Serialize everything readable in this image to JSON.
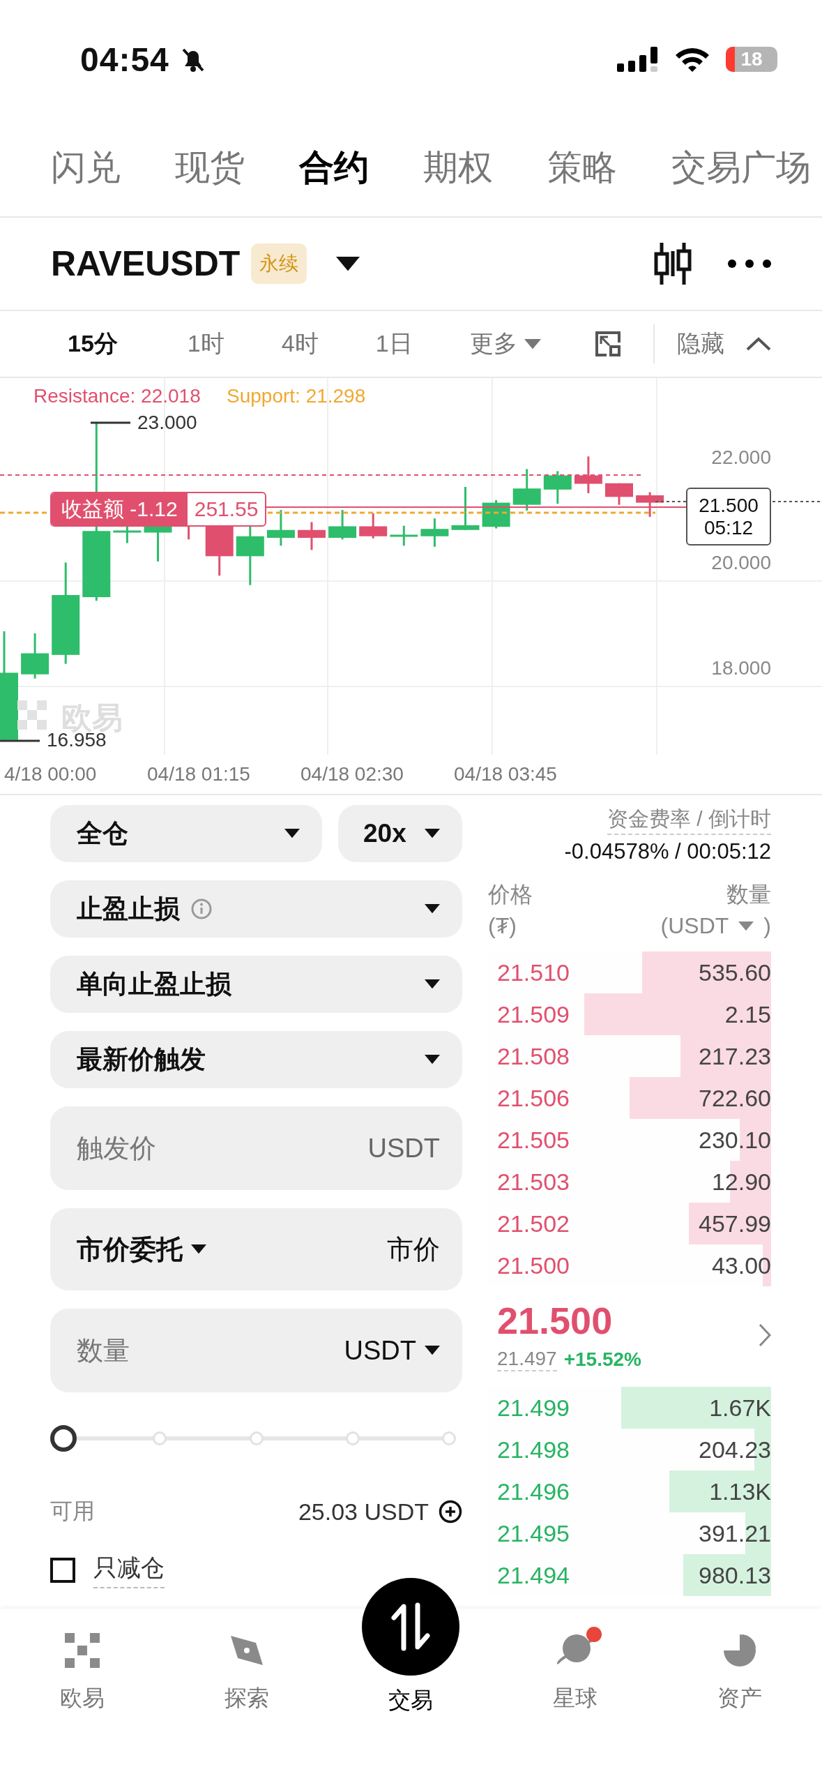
{
  "status_bar": {
    "time": "04:54",
    "battery": "18"
  },
  "top_tabs": [
    {
      "label": "闪兑",
      "selected": false
    },
    {
      "label": "现货",
      "selected": false
    },
    {
      "label": "合约",
      "selected": true
    },
    {
      "label": "期权",
      "selected": false
    },
    {
      "label": "策略",
      "selected": false
    },
    {
      "label": "交易广场",
      "selected": false
    }
  ],
  "symbol": {
    "name": "RAVEUSDT",
    "badge": "永续"
  },
  "timeframes": [
    {
      "label": "15分",
      "selected": true
    },
    {
      "label": "1时",
      "selected": false
    },
    {
      "label": "4时",
      "selected": false
    },
    {
      "label": "1日",
      "selected": false
    }
  ],
  "more": "更多",
  "hide": "隐藏",
  "chart": {
    "resistance": "Resistance: 22.018",
    "support": "Support: 21.298",
    "high": "23.000",
    "low": "16.958",
    "watermark": "欧易",
    "position_label": "收益额 -1.12",
    "position_value": "251.55",
    "price_tag": "21.500",
    "countdown": "05:12",
    "y_ticks": [
      "22.000",
      "20.000",
      "18.000"
    ],
    "x_ticks": [
      "4/18 00:00",
      "04/18 01:15",
      "04/18 02:30",
      "04/18 03:45"
    ]
  },
  "order_form": {
    "margin_mode": "全仓",
    "leverage": "20x",
    "tpsl": "止盈止损",
    "tpsl_mode": "单向止盈止损",
    "trigger_type": "最新价触发",
    "trigger_price": {
      "placeholder": "触发价",
      "unit": "USDT"
    },
    "order_type": "市价委托",
    "order_price": "市价",
    "amount": {
      "placeholder": "数量",
      "unit": "USDT"
    },
    "slider": {
      "level": 0
    },
    "available_label": "可用",
    "available": "25.03 USDT",
    "reduce_only": {
      "label": "只减仓",
      "checked": false
    }
  },
  "order_book": {
    "funding_label": "资金费率 / 倒计时",
    "funding_value": "-0.04578% / 00:05:12",
    "price_header": "价格",
    "price_unit": "(₮)",
    "amount_header": "数量",
    "amount_unit": "(USDT",
    "amount_unit_close": ")",
    "asks": [
      {
        "price": "21.510",
        "amount": "535.60",
        "level": 0.455
      },
      {
        "price": "21.509",
        "amount": "2.15",
        "level": 0.66
      },
      {
        "price": "21.508",
        "amount": "217.23",
        "level": 0.32
      },
      {
        "price": "21.506",
        "amount": "722.60",
        "level": 0.5
      },
      {
        "price": "21.505",
        "amount": "230.10",
        "level": 0.11
      },
      {
        "price": "21.503",
        "amount": "12.90",
        "level": 0.145
      },
      {
        "price": "21.502",
        "amount": "457.99",
        "level": 0.29
      },
      {
        "price": "21.500",
        "amount": "43.00",
        "level": 0.03
      }
    ],
    "last_price": "21.500",
    "mark_price": "21.497",
    "change": "+15.52%",
    "bids": [
      {
        "price": "21.499",
        "amount": "1.67K",
        "level": 0.53
      },
      {
        "price": "21.498",
        "amount": "204.23",
        "level": 0.06
      },
      {
        "price": "21.496",
        "amount": "1.13K",
        "level": 0.36
      },
      {
        "price": "21.495",
        "amount": "391.21",
        "level": 0.09
      },
      {
        "price": "21.494",
        "amount": "980.13",
        "level": 0.31
      }
    ]
  },
  "bottom_nav": [
    {
      "label": "欧易",
      "selected": false,
      "dot": false
    },
    {
      "label": "探索",
      "selected": false,
      "dot": false
    },
    {
      "label": "交易",
      "selected": true,
      "dot": false
    },
    {
      "label": "星球",
      "selected": false,
      "dot": true
    },
    {
      "label": "资产",
      "selected": false,
      "dot": false
    }
  ]
}
